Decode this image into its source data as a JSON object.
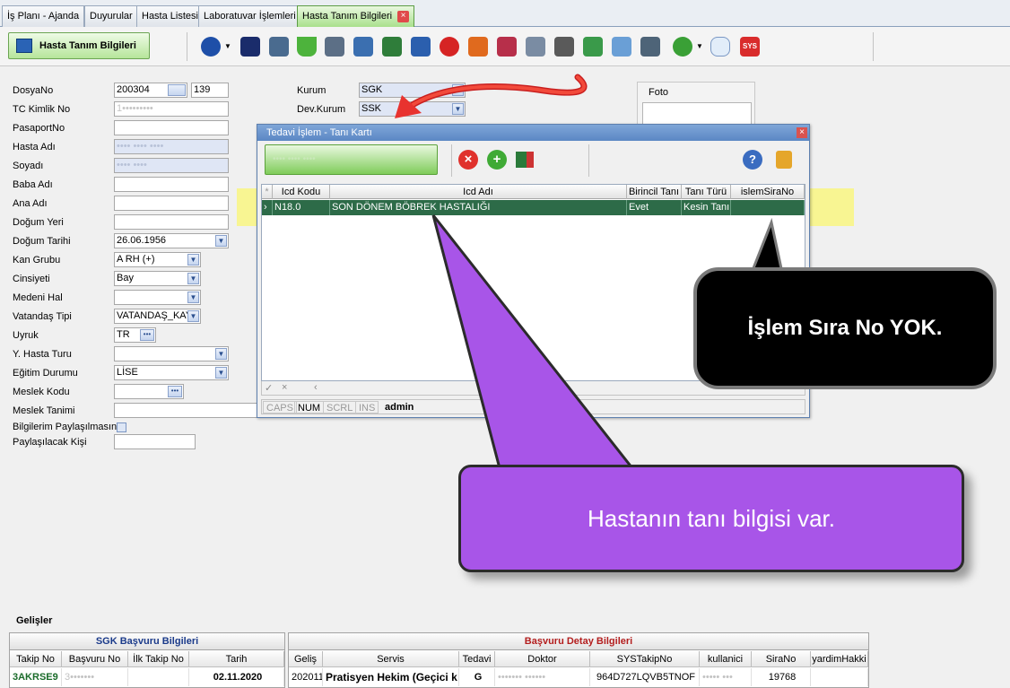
{
  "tabs": [
    {
      "label": "İş Planı - Ajanda"
    },
    {
      "label": "Duyurular"
    },
    {
      "label": "Hasta Listesi"
    },
    {
      "label": "Laboratuvar İşlemleri"
    },
    {
      "label": "Hasta Tanım Bilgileri",
      "active": true
    }
  ],
  "toolbar": {
    "form_title": "Hasta Tanım Bilgileri",
    "icons": [
      "menu-icon",
      "save-icon",
      "print-icon",
      "lab-flask-icon",
      "checklist-icon",
      "microscope-icon",
      "info-icon",
      "report-icon",
      "red-ball-icon",
      "ticket-icon",
      "medical-info-icon",
      "mail-icon",
      "doctor-info-icon",
      "pen-icon",
      "table-add-icon",
      "device-icon",
      "download-icon",
      "comment-icon",
      "sys-icon"
    ]
  },
  "form": {
    "dosya_no_label": "DosyaNo",
    "dosya_no": "200304",
    "dosya_no2": "139",
    "tc_label": "TC Kimlik No",
    "tc_value": "1•••••••••",
    "pasaport_label": "PasaportNo",
    "ad_label": "Hasta Adı",
    "ad_value": "•••• •••• ••••",
    "soyad_label": "Soyadı",
    "soyad_value": "•••• ••••",
    "baba_label": "Baba Adı",
    "ana_label": "Ana Adı",
    "dogum_yeri_label": "Doğum Yeri",
    "dogum_tarihi_label": "Doğum Tarihi",
    "dogum_tarihi": "26.06.1956",
    "kan_label": "Kan Grubu",
    "kan_value": "A RH (+)",
    "cinsiyet_label": "Cinsiyeti",
    "cinsiyet_value": "Bay",
    "medeni_label": "Medeni Hal",
    "vatandas_label": "Vatandaş Tipi",
    "vatandas_value": "VATANDAŞ_KAY",
    "uyruk_label": "Uyruk",
    "uyruk_value": "TR",
    "yhasta_label": "Y. Hasta Turu",
    "egitim_label": "Eğitim Durumu",
    "egitim_value": "LİSE",
    "meslek_kod_label": "Meslek Kodu",
    "meslek_tanim_label": "Meslek Tanimi",
    "paylas_label": "Bilgilerim Paylaşılmasın",
    "paylas_kisi_label": "Paylaşılacak Kişi",
    "kurum_label": "Kurum",
    "kurum_value": "SGK",
    "devkurum_label": "Dev.Kurum",
    "devkurum_value": "SSK",
    "foto_label": "Foto"
  },
  "dialog": {
    "title": "Tedavi İşlem - Tanı Kartı",
    "patient_button": "•••• •••• ••••",
    "columns": [
      "Icd Kodu",
      "Icd Adı",
      "Birincil Tanı",
      "Tanı Türü",
      "islemSiraNo"
    ],
    "rows": [
      {
        "icd_kodu": "N18.0",
        "icd_adi": "SON DÖNEM BÖBREK HASTALIĞI",
        "birincil": "Evet",
        "tur": "Kesin Tanı",
        "sira": ""
      }
    ],
    "status": {
      "caps": "CAPS",
      "num": "NUM",
      "scrl": "SCRL",
      "ins": "INS",
      "user": "admin"
    }
  },
  "callouts": {
    "black": "İşlem Sıra No YOK.",
    "purple": "Hastanın tanı bilgisi var."
  },
  "bottom": {
    "title": "Gelişler",
    "sgk_group": "SGK Başvuru Bilgileri",
    "detay_group": "Başvuru Detay Bilgileri",
    "sgk_cols": [
      "Takip No",
      "Başvuru No",
      "İlk Takip No",
      "Tarih"
    ],
    "detay_cols": [
      "Geliş",
      "Servis",
      "Tedavi",
      "Doktor",
      "SYSTakipNo",
      "kullanici",
      "SiraNo",
      "yardimHakki"
    ],
    "row": {
      "takip_no": "3AKRSE9",
      "basvuru_no": "3•••••••",
      "ilk_takip": "",
      "tarih": "02.11.2020",
      "gelis": "202011",
      "servis": "Pratisyen Hekim (Geçici k",
      "tedavi": "G",
      "doktor": "••••••• ••••••",
      "sys": "964D727LQVB5TNOF",
      "kullanici": "••••• •••",
      "sira": "19768",
      "yardim": ""
    }
  },
  "colors": {
    "active_tab": "#a9e08d",
    "row_selected": "#2d6b48",
    "callout_purple": "#a855e8",
    "arrow_red": "#e8332f"
  }
}
